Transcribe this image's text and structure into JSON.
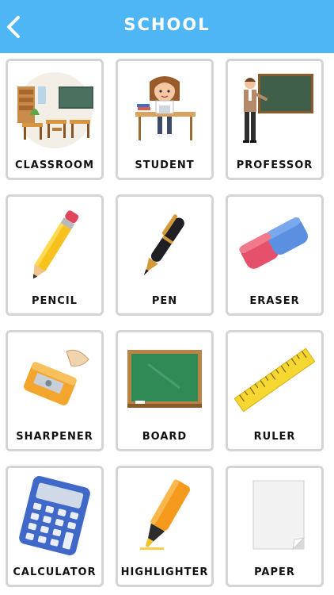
{
  "header": {
    "title": "SCHOOL",
    "back_icon": "chevron-left-icon",
    "color": "#4fb6f5"
  },
  "cards": [
    {
      "label": "CLASSROOM",
      "icon": "classroom-illustration"
    },
    {
      "label": "STUDENT",
      "icon": "student-illustration"
    },
    {
      "label": "PROFESSOR",
      "icon": "professor-illustration"
    },
    {
      "label": "PENCIL",
      "icon": "pencil-illustration"
    },
    {
      "label": "PEN",
      "icon": "pen-illustration"
    },
    {
      "label": "ERASER",
      "icon": "eraser-illustration"
    },
    {
      "label": "SHARPENER",
      "icon": "sharpener-illustration"
    },
    {
      "label": "BOARD",
      "icon": "board-illustration"
    },
    {
      "label": "RULER",
      "icon": "ruler-illustration"
    },
    {
      "label": "CALCULATOR",
      "icon": "calculator-illustration"
    },
    {
      "label": "HIGHLIGHTER",
      "icon": "highlighter-illustration"
    },
    {
      "label": "PAPER",
      "icon": "paper-illustration"
    }
  ]
}
